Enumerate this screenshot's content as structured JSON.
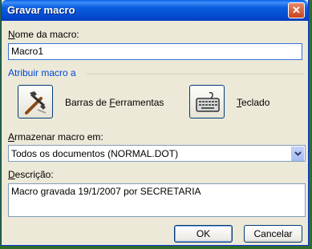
{
  "window": {
    "title": "Gravar macro",
    "close_glyph": "✕"
  },
  "macro_name": {
    "label": "Nome da macro:",
    "label_underline": "N",
    "label_rest": "ome da macro:",
    "value": "Macro1"
  },
  "assign": {
    "group_title": "Atribuir macro a",
    "toolbars": {
      "label": "Barras de Ferramentas",
      "pre": "Barras de ",
      "underline": "F",
      "post": "erramentas",
      "icon": "hammer-icon"
    },
    "keyboard": {
      "label": "Teclado",
      "underline": "T",
      "post": "eclado",
      "icon": "keyboard-icon"
    }
  },
  "store": {
    "label": "Armazenar macro em:",
    "label_underline": "A",
    "label_rest": "rmazenar macro em:",
    "selected": "Todos os documentos (NORMAL.DOT)"
  },
  "description": {
    "label": "Descrição:",
    "label_underline": "D",
    "label_rest": "escrição:",
    "value": "Macro gravada 19/1/2007 por SECRETARIA"
  },
  "buttons": {
    "ok": "OK",
    "cancel": "Cancelar"
  },
  "colors": {
    "titlebar": "#0447cf",
    "dialog_bg": "#ece9d8",
    "group_title": "#0046d5"
  }
}
